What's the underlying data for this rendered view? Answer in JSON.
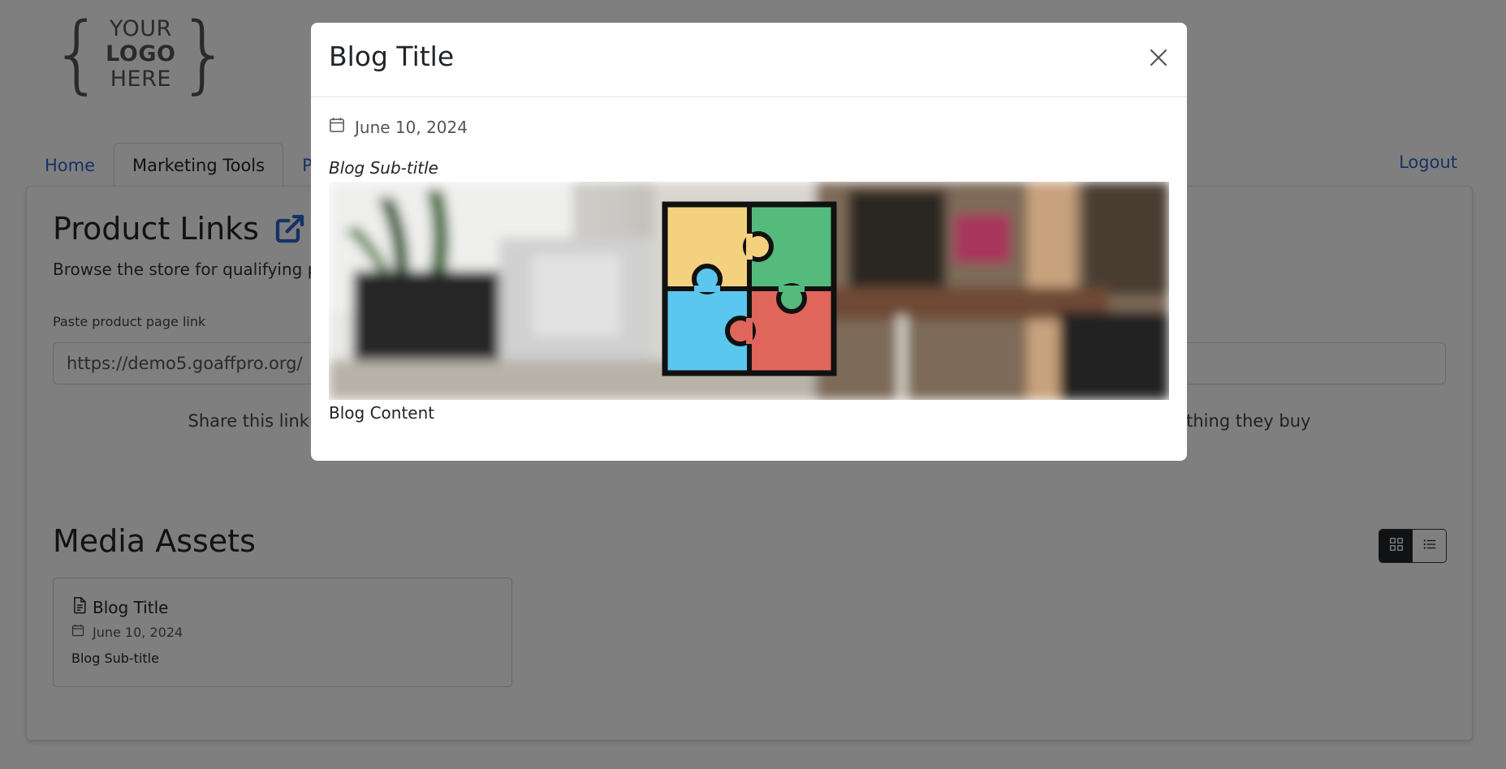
{
  "logo": {
    "line1": "YOUR",
    "line2": "LOGO",
    "line3": "HERE"
  },
  "nav": {
    "tabs": [
      {
        "label": "Home"
      },
      {
        "label": "Marketing Tools"
      },
      {
        "label": "Po"
      }
    ],
    "logout": "Logout"
  },
  "product_links": {
    "title": "Product Links",
    "description": "Browse the store for qualifying p",
    "field_label": "Paste product page link",
    "input_value": "https://demo5.goaffpro.org/",
    "share_text_left": "Share this link on",
    "share_text_right": "erything they buy"
  },
  "media_assets": {
    "title": "Media Assets",
    "card": {
      "title": "Blog Title",
      "date": "June 10, 2024",
      "subtitle": "Blog Sub-title"
    }
  },
  "modal": {
    "title": "Blog Title",
    "date": "June 10, 2024",
    "subtitle": "Blog Sub-title",
    "content": "Blog Content"
  },
  "colors": {
    "link": "#2d64c8",
    "puzzle_yellow": "#f3d17e",
    "puzzle_green": "#55bb7c",
    "puzzle_blue": "#5bc6ee",
    "puzzle_red": "#e0665c",
    "backdrop": "rgba(0,0,0,0.5)"
  },
  "icons": {
    "close": "close-icon",
    "calendar": "calendar-icon",
    "external_link": "external-link-icon",
    "grid_view": "grid-icon",
    "list_view": "list-icon",
    "document": "document-icon"
  }
}
